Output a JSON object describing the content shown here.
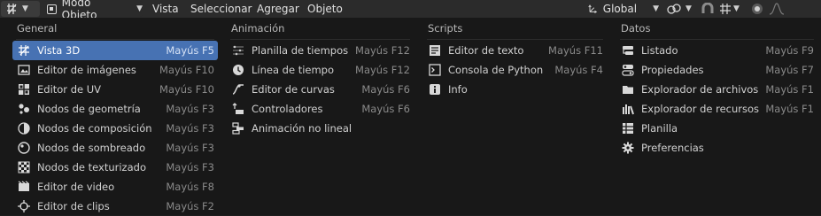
{
  "topbar": {
    "mode_label": "Modo Objeto",
    "menus": [
      "Vista",
      "Seleccionar",
      "Agregar",
      "Objeto"
    ],
    "orientation_label": "Global"
  },
  "columns": [
    {
      "title": "General",
      "items": [
        {
          "label": "Vista 3D",
          "shortcut": "Mayús F5",
          "icon": "view3d-icon",
          "active": true
        },
        {
          "label": "Editor de imágenes",
          "shortcut": "Mayús F10",
          "icon": "image-editor-icon"
        },
        {
          "label": "Editor de UV",
          "shortcut": "Mayús F10",
          "icon": "uv-editor-icon"
        },
        {
          "label": "Nodos de geometría",
          "shortcut": "Mayús F3",
          "icon": "geometry-nodes-icon"
        },
        {
          "label": "Nodos de composición",
          "shortcut": "Mayús F3",
          "icon": "compositor-nodes-icon"
        },
        {
          "label": "Nodos de sombreado",
          "shortcut": "Mayús F3",
          "icon": "shader-nodes-icon"
        },
        {
          "label": "Nodos de texturizado",
          "shortcut": "Mayús F3",
          "icon": "texture-nodes-icon"
        },
        {
          "label": "Editor de video",
          "shortcut": "Mayús F8",
          "icon": "video-editor-icon"
        },
        {
          "label": "Editor de clips",
          "shortcut": "Mayús F2",
          "icon": "clip-editor-icon"
        }
      ]
    },
    {
      "title": "Animación",
      "items": [
        {
          "label": "Planilla de tiempos",
          "shortcut": "Mayús F12",
          "icon": "dopesheet-icon"
        },
        {
          "label": "Línea de tiempo",
          "shortcut": "Mayús F12",
          "icon": "timeline-icon"
        },
        {
          "label": "Editor de curvas",
          "shortcut": "Mayús F6",
          "icon": "graph-editor-icon"
        },
        {
          "label": "Controladores",
          "shortcut": "Mayús F6",
          "icon": "drivers-icon"
        },
        {
          "label": "Animación no lineal",
          "shortcut": "",
          "icon": "nla-icon"
        }
      ]
    },
    {
      "title": "Scripts",
      "items": [
        {
          "label": "Editor de texto",
          "shortcut": "Mayús F11",
          "icon": "text-editor-icon"
        },
        {
          "label": "Consola de Python",
          "shortcut": "Mayús F4",
          "icon": "console-icon"
        },
        {
          "label": "Info",
          "shortcut": "",
          "icon": "info-icon"
        }
      ]
    },
    {
      "title": "Datos",
      "items": [
        {
          "label": "Listado",
          "shortcut": "Mayús F9",
          "icon": "outliner-icon"
        },
        {
          "label": "Propiedades",
          "shortcut": "Mayús F7",
          "icon": "properties-icon"
        },
        {
          "label": "Explorador de archivos",
          "shortcut": "Mayús F1",
          "icon": "file-browser-icon"
        },
        {
          "label": "Explorador de recursos",
          "shortcut": "Mayús F1",
          "icon": "asset-browser-icon"
        },
        {
          "label": "Planilla",
          "shortcut": "",
          "icon": "spreadsheet-icon"
        },
        {
          "label": "Preferencias",
          "shortcut": "",
          "icon": "preferences-icon"
        }
      ]
    }
  ]
}
